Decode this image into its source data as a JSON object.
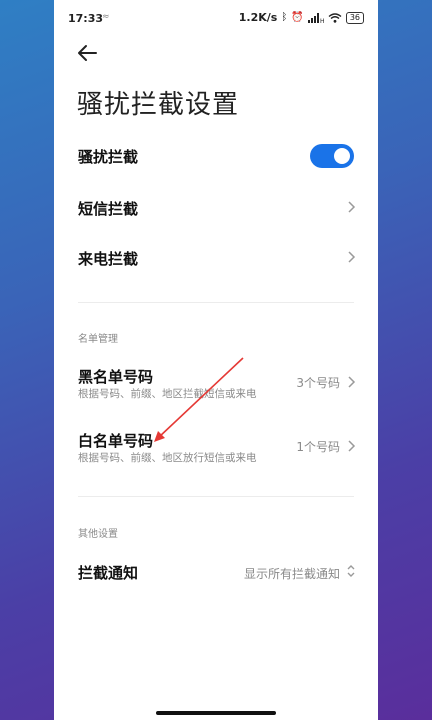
{
  "status_bar": {
    "time": "17:33",
    "notification_icon": "≈",
    "network_speed": "1.2K/s",
    "battery": "36"
  },
  "page": {
    "title": "骚扰拦截设置"
  },
  "settings": {
    "harassment_block": {
      "label": "骚扰拦截",
      "enabled": true
    },
    "sms_block": {
      "label": "短信拦截"
    },
    "call_block": {
      "label": "来电拦截"
    }
  },
  "list_management": {
    "header": "名单管理",
    "blacklist": {
      "label": "黑名单号码",
      "description": "根据号码、前缀、地区拦截短信或来电",
      "count": "3个号码"
    },
    "whitelist": {
      "label": "白名单号码",
      "description": "根据号码、前缀、地区放行短信或来电",
      "count": "1个号码"
    }
  },
  "other_settings": {
    "header": "其他设置",
    "block_notification": {
      "label": "拦截通知",
      "value": "显示所有拦截通知"
    }
  },
  "colors": {
    "accent": "#1a73e8",
    "annotation_arrow": "#e53935"
  },
  "icons": [
    "back-arrow-icon",
    "chevron-right-icon",
    "updown-chevron-icon",
    "bluetooth-icon",
    "alarm-icon",
    "signal-icon",
    "wifi-icon",
    "battery-icon"
  ]
}
